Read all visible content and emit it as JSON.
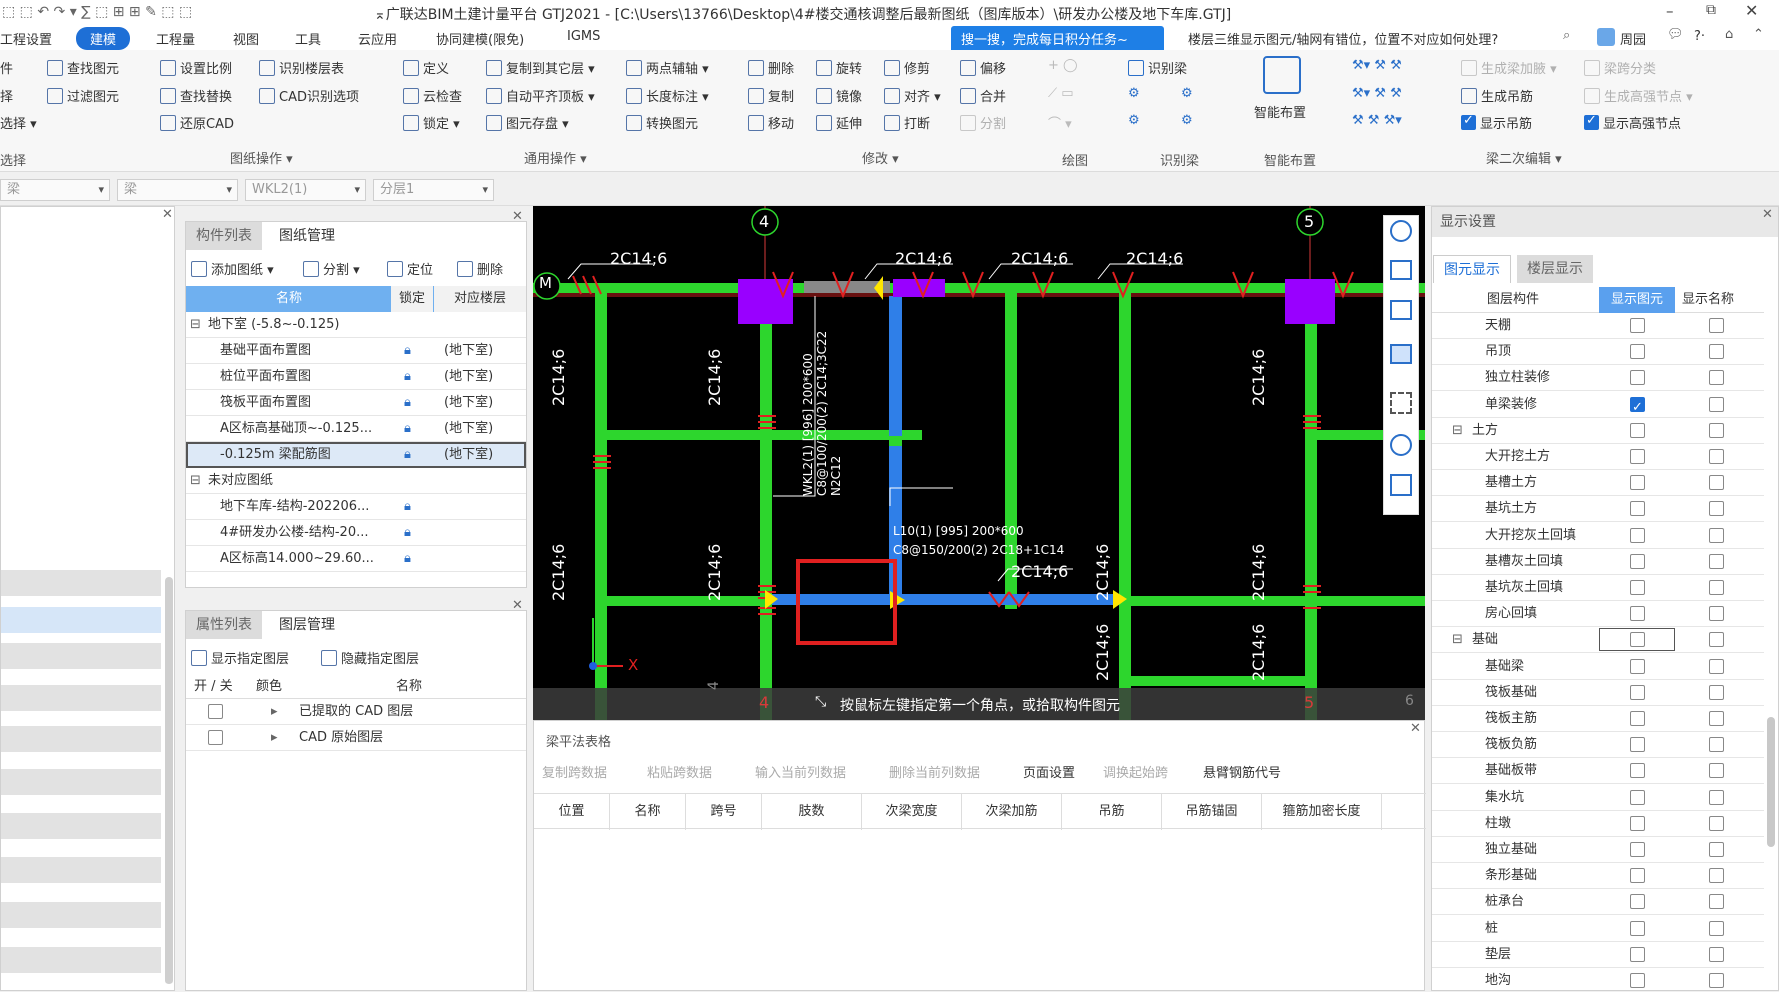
{
  "title_bar": {
    "title": "⌅广联达BIM土建计量平台 GTJ2021 - [C:\\Users\\13766\\Desktop\\4#楼交通核调整后最新图纸（图库版本）\\研发办公楼及地下车库.GTJ]"
  },
  "menu": {
    "items": [
      "工程设置",
      "建模",
      "工程量",
      "视图",
      "工具",
      "云应用",
      "协同建模(限免)",
      "IGMS"
    ],
    "active": "建模",
    "promo": "搜一搜，完成每日积分任务~",
    "search_text": "楼层三维显示图元/轴网有错位，位置不对应如何处理?",
    "user": "周园",
    "help": "?·"
  },
  "ribbon": {
    "left_cut": [
      "件",
      "择",
      "选择 ▾"
    ],
    "g1": {
      "items": [
        "查找图元",
        "过滤图元"
      ]
    },
    "g2": {
      "items": [
        "设置比例",
        "识别楼层表",
        "查找替换",
        "CAD识别选项",
        "还原CAD"
      ],
      "label": "图纸操作 ▾"
    },
    "g3": {
      "items": [
        "定义",
        "复制到其它层 ▾",
        "两点辅轴 ▾",
        "云检查",
        "自动平齐顶板 ▾",
        "长度标注 ▾",
        "锁定 ▾",
        "图元存盘 ▾",
        "转换图元"
      ],
      "label": "通用操作 ▾"
    },
    "g4": {
      "items": [
        "删除",
        "旋转",
        "修剪",
        "偏移",
        "复制",
        "镜像",
        "对齐 ▾",
        "合并",
        "移动",
        "延伸",
        "打断",
        "分割"
      ],
      "label": "修改 ▾"
    },
    "g5": {
      "label": "绘图"
    },
    "g6": {
      "items": [
        "识别梁"
      ],
      "label": "识别梁"
    },
    "g7": {
      "items": [
        "智能布置"
      ],
      "label": "智能布置"
    },
    "g8": {
      "items": [
        "生成梁加腋 ▾",
        "梁跨分类",
        "生成吊筋",
        "生成高强节点 ▾",
        "显示吊筋",
        "显示高强节点"
      ],
      "label": "梁二次编辑 ▾"
    },
    "group_left_label": "选择"
  },
  "selector": {
    "combo1": "梁",
    "combo2": "梁",
    "combo3": "WKL2(1)",
    "combo4": "分层1"
  },
  "drawing_panel": {
    "tabs": [
      "构件列表",
      "图纸管理"
    ],
    "active": "图纸管理",
    "toolbar": [
      "添加图纸 ▾",
      "分割 ▾",
      "定位",
      "删除"
    ],
    "headers": [
      "名称",
      "锁定",
      "对应楼层"
    ],
    "rows": [
      {
        "name": "地下室 (-5.8~-0.125)",
        "group": true,
        "floor": ""
      },
      {
        "name": "基础平面布置图",
        "floor": "(地下室)"
      },
      {
        "name": "桩位平面布置图",
        "floor": "(地下室)"
      },
      {
        "name": "筏板平面布置图",
        "floor": "(地下室)"
      },
      {
        "name": "A区标高基础顶~-0.125...",
        "floor": "(地下室)"
      },
      {
        "name": "-0.125m 梁配筋图",
        "floor": "(地下室)",
        "selected": true
      },
      {
        "name": "未对应图纸",
        "group": true,
        "floor": ""
      },
      {
        "name": "地下车库-结构-202206...",
        "floor": ""
      },
      {
        "name": "4#研发办公楼-结构-20...",
        "floor": ""
      },
      {
        "name": "A区标高14.000~29.60...",
        "floor": ""
      }
    ]
  },
  "layer_panel": {
    "tabs": [
      "属性列表",
      "图层管理"
    ],
    "active": "图层管理",
    "toolbar": [
      "显示指定图层",
      "隐藏指定图层"
    ],
    "headers": [
      "开 / 关",
      "颜色",
      "名称"
    ],
    "rows": [
      "已提取的 CAD 图层",
      "CAD 原始图层"
    ]
  },
  "canvas": {
    "axis_labels": [
      "M",
      "4",
      "5"
    ],
    "bottom_axis": [
      "4",
      "4",
      "5",
      "6"
    ],
    "status": "按鼠标左键指定第一个角点，或拾取构件图元",
    "beam_texts": {
      "top1": "2C14;6",
      "top2": "2C14;6",
      "top3": "2C14;6",
      "top4": "2C14;6",
      "mid": "2C14;6",
      "v1": "2C14;6",
      "v2": "2C14;6",
      "v3": "2C14;6",
      "v4": "2C14;6",
      "v5": "2C14;6",
      "v6": "2C14;6",
      "v7": "2C14;6",
      "v8": "2C14;6",
      "vb1": "2C14;6",
      "vb2": "2C14;6",
      "bottom": "2C14;6"
    },
    "wkl_label": [
      "WKL2(1) [996] 200*600",
      "C8@100/200(2) 2C14;3C22",
      "N2C12"
    ],
    "l_label": [
      "L10(1) [995] 200*600",
      "C8@150/200(2) 2C18+1C14"
    ],
    "axis_x": "X"
  },
  "beam_table": {
    "title": "梁平法表格",
    "toolbar": [
      "复制跨数据",
      "粘贴跨数据",
      "输入当前列数据",
      "删除当前列数据",
      "页面设置",
      "调换起始跨",
      "悬臂钢筋代号"
    ],
    "enabled": [
      false,
      false,
      false,
      false,
      true,
      false,
      true
    ],
    "headers": [
      "位置",
      "名称",
      "跨号",
      "肢数",
      "次梁宽度",
      "次梁加筋",
      "吊筋",
      "吊筋锚固",
      "箍筋加密长度"
    ]
  },
  "display_panel": {
    "title": "显示设置",
    "tabs": [
      "图元显示",
      "楼层显示"
    ],
    "active": "图元显示",
    "headers": [
      "图层构件",
      "显示图元",
      "显示名称"
    ],
    "rows": [
      {
        "name": "天棚",
        "level": 1,
        "show": false
      },
      {
        "name": "吊顶",
        "level": 1,
        "show": false
      },
      {
        "name": "独立柱装修",
        "level": 1,
        "show": false
      },
      {
        "name": "单梁装修",
        "level": 1,
        "show": true
      },
      {
        "name": "土方",
        "level": 0,
        "show": false
      },
      {
        "name": "大开挖土方",
        "level": 1,
        "show": false
      },
      {
        "name": "基槽土方",
        "level": 1,
        "show": false
      },
      {
        "name": "基坑土方",
        "level": 1,
        "show": false
      },
      {
        "name": "大开挖灰土回填",
        "level": 1,
        "show": false
      },
      {
        "name": "基槽灰土回填",
        "level": 1,
        "show": false
      },
      {
        "name": "基坑灰土回填",
        "level": 1,
        "show": false
      },
      {
        "name": "房心回填",
        "level": 1,
        "show": false
      },
      {
        "name": "基础",
        "level": 0,
        "show": false
      },
      {
        "name": "基础梁",
        "level": 1,
        "show": false
      },
      {
        "name": "筏板基础",
        "level": 1,
        "show": false
      },
      {
        "name": "筏板主筋",
        "level": 1,
        "show": false
      },
      {
        "name": "筏板负筋",
        "level": 1,
        "show": false
      },
      {
        "name": "基础板带",
        "level": 1,
        "show": false
      },
      {
        "name": "集水坑",
        "level": 1,
        "show": false
      },
      {
        "name": "柱墩",
        "level": 1,
        "show": false
      },
      {
        "name": "独立基础",
        "level": 1,
        "show": false
      },
      {
        "name": "条形基础",
        "level": 1,
        "show": false
      },
      {
        "name": "桩承台",
        "level": 1,
        "show": false
      },
      {
        "name": "桩",
        "level": 1,
        "show": false
      },
      {
        "name": "垫层",
        "level": 1,
        "show": false
      },
      {
        "name": "地沟",
        "level": 1,
        "show": false
      }
    ]
  },
  "colors": {
    "accent": "#1e6fd6",
    "beam": "#2dd62d",
    "selected_beam": "#2f7fe8",
    "column": "#9900ff",
    "highlight_box": "#e02020"
  }
}
